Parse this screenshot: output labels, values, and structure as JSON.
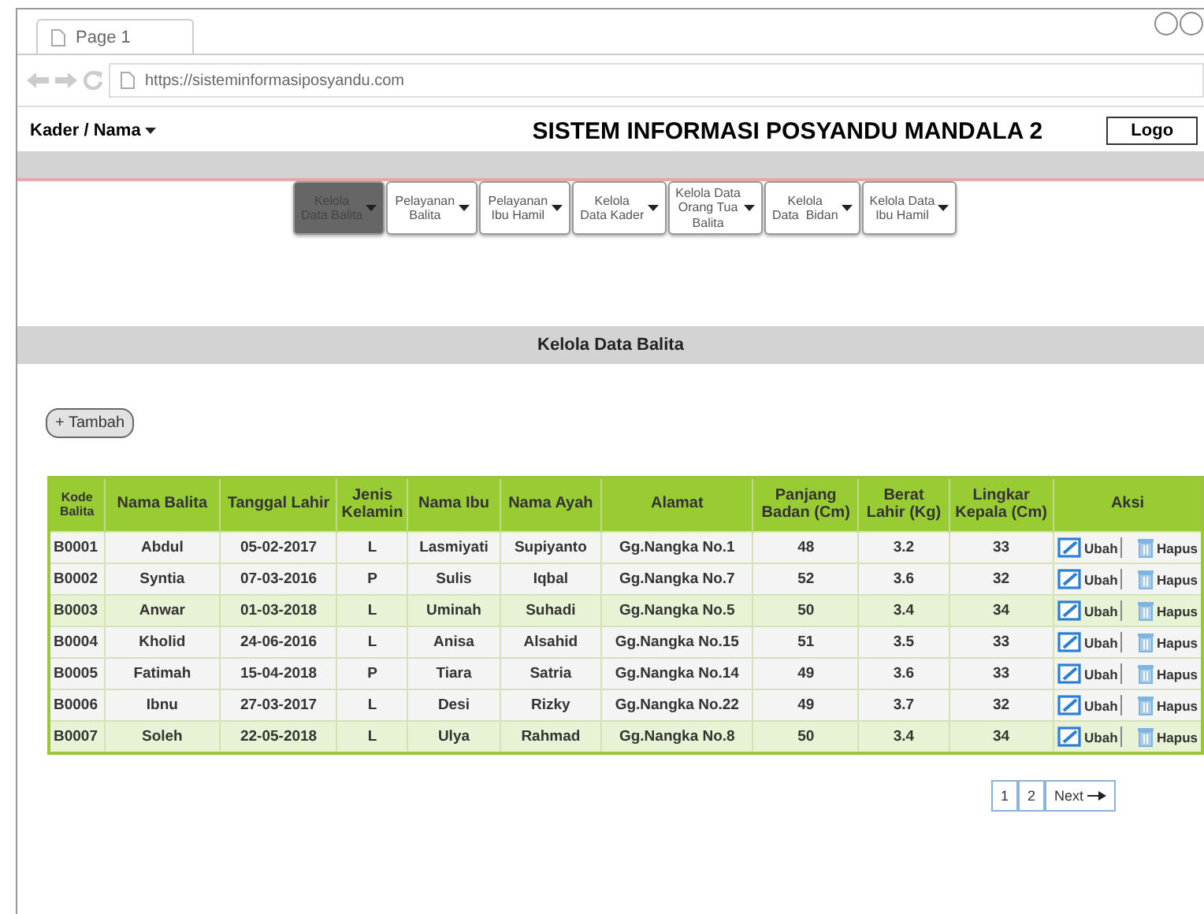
{
  "browser": {
    "tab_title": "Page 1",
    "url": "https://sisteminformasiposyandu.com"
  },
  "header": {
    "user_menu": "Kader / Nama",
    "title": "SISTEM INFORMASI POSYANDU MANDALA 2",
    "logo": "Logo"
  },
  "menu": [
    {
      "label": "Kelola\nData Balita",
      "selected": true
    },
    {
      "label": "Pelayanan\nBalita",
      "selected": false
    },
    {
      "label": "Pelayanan\nIbu Hamil",
      "selected": false
    },
    {
      "label": "Kelola\nData Kader",
      "selected": false
    },
    {
      "label": "Kelola Data\nOrang Tua\nBalita",
      "selected": false
    },
    {
      "label": "Kelola\nData  Bidan",
      "selected": false
    },
    {
      "label": "Kelola Data\nIbu Hamil",
      "selected": false
    }
  ],
  "section_title": "Kelola Data Balita",
  "add_button": "+ Tambah",
  "table": {
    "columns": [
      "Kode\nBalita",
      "Nama Balita",
      "Tanggal Lahir",
      "Jenis\nKelamin",
      "Nama Ibu",
      "Nama Ayah",
      "Alamat",
      "Panjang\nBadan (Cm)",
      "Berat\nLahir (Kg)",
      "Lingkar\nKepala (Cm)",
      "Aksi"
    ],
    "rows": [
      {
        "highlighted": false,
        "cells": [
          "B0001",
          "Abdul",
          "05-02-2017",
          "L",
          "Lasmiyati",
          "Supiyanto",
          "Gg.Nangka No.1",
          "48",
          "3.2",
          "33"
        ],
        "actions": [
          "Ubah",
          "Hapus"
        ]
      },
      {
        "highlighted": false,
        "cells": [
          "B0002",
          "Syntia",
          "07-03-2016",
          "P",
          "Sulis",
          "Iqbal",
          "Gg.Nangka No.7",
          "52",
          "3.6",
          "32"
        ],
        "actions": [
          "Ubah",
          "Hapus"
        ]
      },
      {
        "highlighted": true,
        "cells": [
          "B0003",
          "Anwar",
          "01-03-2018",
          "L",
          "Uminah",
          "Suhadi",
          "Gg.Nangka No.5",
          "50",
          "3.4",
          "34"
        ],
        "actions": [
          "Ubah",
          "Hapus"
        ]
      },
      {
        "highlighted": false,
        "cells": [
          "B0004",
          "Kholid",
          "24-06-2016",
          "L",
          "Anisa",
          "Alsahid",
          "Gg.Nangka No.15",
          "51",
          "3.5",
          "33"
        ],
        "actions": [
          "Ubah",
          "Hapus"
        ]
      },
      {
        "highlighted": false,
        "cells": [
          "B0005",
          "Fatimah",
          "15-04-2018",
          "P",
          "Tiara",
          "Satria",
          "Gg.Nangka No.14",
          "49",
          "3.6",
          "33"
        ],
        "actions": [
          "Ubah",
          "Hapus"
        ]
      },
      {
        "highlighted": false,
        "cells": [
          "B0006",
          "Ibnu",
          "27-03-2017",
          "L",
          "Desi",
          "Rizky",
          "Gg.Nangka No.22",
          "49",
          "3.7",
          "32"
        ],
        "actions": [
          "Ubah",
          "Hapus"
        ]
      },
      {
        "highlighted": true,
        "cells": [
          "B0007",
          "Soleh",
          "22-05-2018",
          "L",
          "Ulya",
          "Rahmad",
          "Gg.Nangka No.8",
          "50",
          "3.4",
          "34"
        ],
        "actions": [
          "Ubah",
          "Hapus"
        ]
      }
    ]
  },
  "pagination": [
    "1",
    "2",
    "Next"
  ]
}
